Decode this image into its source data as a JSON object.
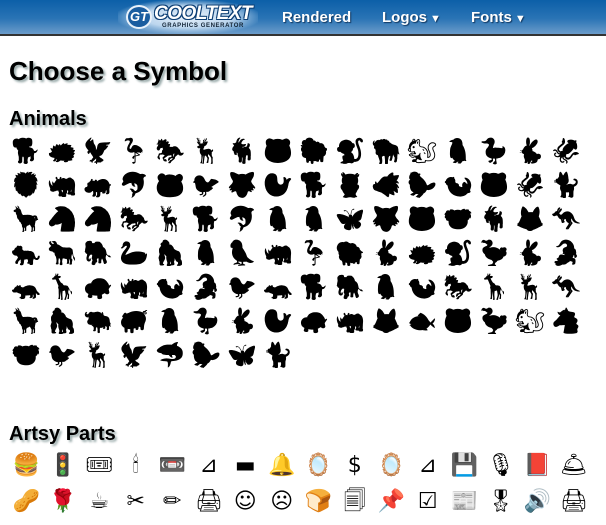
{
  "header": {
    "logo": {
      "badge": "GT",
      "title": "COOLTEXT",
      "subtitle": "GRAPHICS GENERATOR"
    },
    "nav": [
      {
        "label": "Rendered",
        "dropdown": false
      },
      {
        "label": "Logos",
        "dropdown": true,
        "arrow": "▼"
      },
      {
        "label": "Fonts",
        "dropdown": true,
        "arrow": "▼"
      }
    ],
    "colors": {
      "top": "#0c5fa8",
      "bottom": "#6b9cca"
    }
  },
  "page_title": "Choose a Symbol",
  "sections": [
    {
      "title": "Animals",
      "symbols": [
        {
          "name": "dog",
          "glyph": "🐕"
        },
        {
          "name": "armadillo",
          "glyph": "🦔"
        },
        {
          "name": "eagle",
          "glyph": "🦅"
        },
        {
          "name": "crane",
          "glyph": "🦩"
        },
        {
          "name": "horse",
          "glyph": "🐎"
        },
        {
          "name": "deer",
          "glyph": "🦌"
        },
        {
          "name": "ibex",
          "glyph": "🐐"
        },
        {
          "name": "bear-cub",
          "glyph": "🐻"
        },
        {
          "name": "lamb",
          "glyph": "🐑"
        },
        {
          "name": "monkey",
          "glyph": "🐒"
        },
        {
          "name": "bison",
          "glyph": "🦬"
        },
        {
          "name": "squirrel",
          "glyph": "🐿"
        },
        {
          "name": "penguin",
          "glyph": "🐧"
        },
        {
          "name": "duck",
          "glyph": "🦆"
        },
        {
          "name": "rabbit",
          "glyph": "🐇"
        },
        {
          "name": "seahorse",
          "glyph": "🦑"
        },
        {
          "name": "lion",
          "glyph": "🦁"
        },
        {
          "name": "rhino",
          "glyph": "🦏"
        },
        {
          "name": "hippo",
          "glyph": "🦛"
        },
        {
          "name": "dolphin",
          "glyph": "🐬"
        },
        {
          "name": "panda",
          "glyph": "🐼"
        },
        {
          "name": "puffin",
          "glyph": "🐦"
        },
        {
          "name": "wolf",
          "glyph": "🐺"
        },
        {
          "name": "seal",
          "glyph": "🦭"
        },
        {
          "name": "hound",
          "glyph": "🐕"
        },
        {
          "name": "owl",
          "glyph": "🦉"
        },
        {
          "name": "boar",
          "glyph": "🐗"
        },
        {
          "name": "platypus",
          "glyph": "🦫"
        },
        {
          "name": "otter",
          "glyph": "🦦"
        },
        {
          "name": "bear-standing",
          "glyph": "🐻"
        },
        {
          "name": "seahorse-2",
          "glyph": "🦑"
        },
        {
          "name": "kitten",
          "glyph": "🐈"
        },
        {
          "name": "llama",
          "glyph": "🦙"
        },
        {
          "name": "zebra",
          "glyph": "🦓"
        },
        {
          "name": "zebra-2",
          "glyph": "🦓"
        },
        {
          "name": "horse-2",
          "glyph": "🐎"
        },
        {
          "name": "gazelle",
          "glyph": "🦌"
        },
        {
          "name": "dog-2",
          "glyph": "🐕"
        },
        {
          "name": "dolphin-2",
          "glyph": "🐬"
        },
        {
          "name": "penguin-2",
          "glyph": "🐧"
        },
        {
          "name": "penguin-3",
          "glyph": "🐧"
        },
        {
          "name": "butterfly",
          "glyph": "🦋"
        },
        {
          "name": "hyena",
          "glyph": "🐺"
        },
        {
          "name": "bear",
          "glyph": "🐻"
        },
        {
          "name": "koala",
          "glyph": "🐨"
        },
        {
          "name": "ibex-2",
          "glyph": "🐐"
        },
        {
          "name": "fox",
          "glyph": "🦊"
        },
        {
          "name": "kangaroo",
          "glyph": "🦘"
        },
        {
          "name": "tiger",
          "glyph": "🐅"
        },
        {
          "name": "ox",
          "glyph": "🐂"
        },
        {
          "name": "elephant",
          "glyph": "🐘"
        },
        {
          "name": "swan",
          "glyph": "🦢"
        },
        {
          "name": "gorilla",
          "glyph": "🦍"
        },
        {
          "name": "penguin-4",
          "glyph": "🐧"
        },
        {
          "name": "parrot",
          "glyph": "🦜"
        },
        {
          "name": "rhino-2",
          "glyph": "🦏"
        },
        {
          "name": "ostrich",
          "glyph": "🦩"
        },
        {
          "name": "sheep",
          "glyph": "🐏"
        },
        {
          "name": "rabbit-2",
          "glyph": "🐇"
        },
        {
          "name": "armadillo-2",
          "glyph": "🦔"
        },
        {
          "name": "monkey-2",
          "glyph": "🐒"
        },
        {
          "name": "pelican",
          "glyph": "🦤"
        },
        {
          "name": "hare",
          "glyph": "🐇"
        },
        {
          "name": "alligator",
          "glyph": "🐊"
        },
        {
          "name": "weasel",
          "glyph": "🦡"
        },
        {
          "name": "giraffe",
          "glyph": "🦒"
        },
        {
          "name": "tortoise",
          "glyph": "🐢"
        },
        {
          "name": "rhino-3",
          "glyph": "🦏"
        },
        {
          "name": "otter-2",
          "glyph": "🦦"
        },
        {
          "name": "crocodile",
          "glyph": "🐊"
        },
        {
          "name": "bird",
          "glyph": "🐦"
        },
        {
          "name": "mongoose",
          "glyph": "🦡"
        },
        {
          "name": "dog-3",
          "glyph": "🐕"
        },
        {
          "name": "elephant-2",
          "glyph": "🐘"
        },
        {
          "name": "penguin-5",
          "glyph": "🐧"
        },
        {
          "name": "ferret",
          "glyph": "🦦"
        },
        {
          "name": "horse-3",
          "glyph": "🐎"
        },
        {
          "name": "giraffe-2",
          "glyph": "🦒"
        },
        {
          "name": "antelope",
          "glyph": "🦌"
        },
        {
          "name": "kangaroo-2",
          "glyph": "🦘"
        },
        {
          "name": "llama-2",
          "glyph": "🦙"
        },
        {
          "name": "gorilla-2",
          "glyph": "🦍"
        },
        {
          "name": "buffalo",
          "glyph": "🐃"
        },
        {
          "name": "pig",
          "glyph": "🐖"
        },
        {
          "name": "penguin-6",
          "glyph": "🐧"
        },
        {
          "name": "duck-2",
          "glyph": "🦆"
        },
        {
          "name": "hare-2",
          "glyph": "🐇"
        },
        {
          "name": "seal-2",
          "glyph": "🦭"
        },
        {
          "name": "turtle",
          "glyph": "🐢"
        },
        {
          "name": "rhino-4",
          "glyph": "🦏"
        },
        {
          "name": "coyote",
          "glyph": "🦊"
        },
        {
          "name": "fish",
          "glyph": "🐟"
        },
        {
          "name": "bear-2",
          "glyph": "🐻"
        },
        {
          "name": "pelican-2",
          "glyph": "🦤"
        },
        {
          "name": "squirrel-2",
          "glyph": "🐿"
        },
        {
          "name": "pony",
          "glyph": "🐴"
        },
        {
          "name": "koala-2",
          "glyph": "🐨"
        },
        {
          "name": "songbird",
          "glyph": "🐦"
        },
        {
          "name": "stag",
          "glyph": "🦌"
        },
        {
          "name": "eagle-2",
          "glyph": "🦅"
        },
        {
          "name": "shark",
          "glyph": "🦈"
        },
        {
          "name": "platypus-2",
          "glyph": "🦫"
        },
        {
          "name": "butterfly-2",
          "glyph": "🦋"
        },
        {
          "name": "cat",
          "glyph": "🐈"
        }
      ]
    },
    {
      "title": "Artsy Parts",
      "symbols": [
        {
          "name": "sandwich",
          "glyph": "🍔"
        },
        {
          "name": "traffic-light",
          "glyph": "🚦"
        },
        {
          "name": "tickets",
          "glyph": "🎟"
        },
        {
          "name": "candlesticks",
          "glyph": "🕯"
        },
        {
          "name": "cassette",
          "glyph": "📼"
        },
        {
          "name": "hanger",
          "glyph": "⊿"
        },
        {
          "name": "stapler",
          "glyph": "▬"
        },
        {
          "name": "bell-handle",
          "glyph": "🔔"
        },
        {
          "name": "mirrors",
          "glyph": "🪞"
        },
        {
          "name": "dollar-signs",
          "glyph": "$"
        },
        {
          "name": "mirrors-2",
          "glyph": "🪞"
        },
        {
          "name": "hanger-2",
          "glyph": "⊿"
        },
        {
          "name": "floppy-disk",
          "glyph": "💾"
        },
        {
          "name": "microphone",
          "glyph": "🎙"
        },
        {
          "name": "book",
          "glyph": "📕"
        },
        {
          "name": "service-bell",
          "glyph": "🛎"
        },
        {
          "name": "peanut",
          "glyph": "🥜"
        },
        {
          "name": "rose",
          "glyph": "🌹"
        },
        {
          "name": "teacup",
          "glyph": "☕"
        },
        {
          "name": "scissors",
          "glyph": "✂"
        },
        {
          "name": "pencil-eraser",
          "glyph": "✏"
        },
        {
          "name": "printer",
          "glyph": "🖨"
        },
        {
          "name": "smiley-face",
          "glyph": "☺"
        },
        {
          "name": "sad-face",
          "glyph": "☹"
        },
        {
          "name": "bread-slice",
          "glyph": "🍞"
        },
        {
          "name": "paper-stack",
          "glyph": "🗐"
        },
        {
          "name": "pushpin",
          "glyph": "📌"
        },
        {
          "name": "checkbox",
          "glyph": "☑"
        },
        {
          "name": "big-news",
          "glyph": "📰"
        },
        {
          "name": "award-ribbon",
          "glyph": "🎖"
        },
        {
          "name": "speakers",
          "glyph": "🔊"
        },
        {
          "name": "printer-2",
          "glyph": "🖨"
        }
      ]
    }
  ]
}
